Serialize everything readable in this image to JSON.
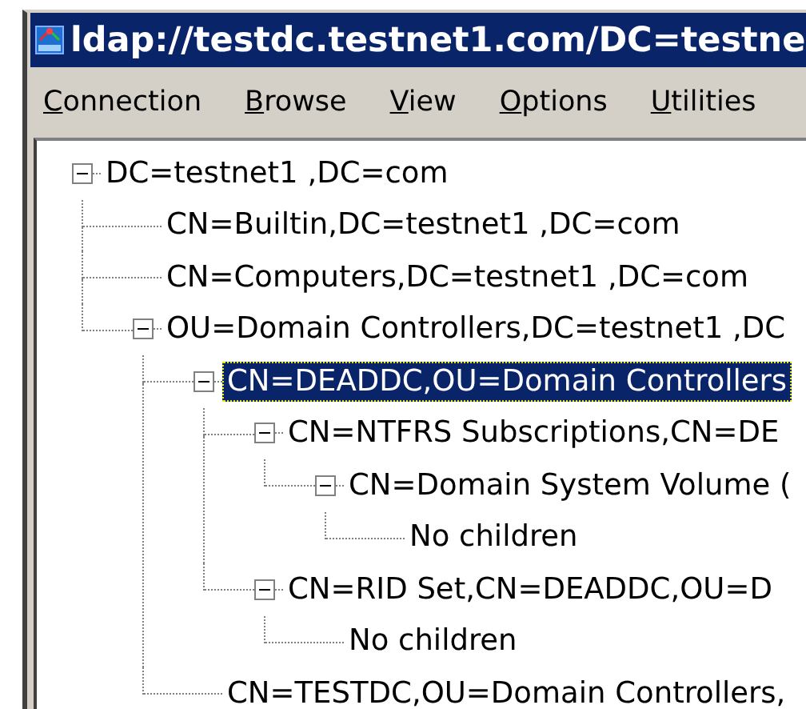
{
  "window": {
    "title": "ldap://testdc.testnet1.com/DC=testne"
  },
  "menu": [
    {
      "label": "Connection"
    },
    {
      "label": "Browse"
    },
    {
      "label": "View"
    },
    {
      "label": "Options"
    },
    {
      "label": "Utilities"
    }
  ],
  "tree": [
    {
      "label": "DC=testnet1 ,DC=com",
      "expanded": true,
      "selected": false,
      "children": [
        {
          "label": "CN=Builtin,DC=testnet1 ,DC=com",
          "selected": false
        },
        {
          "label": "CN=Computers,DC=testnet1 ,DC=com",
          "selected": false
        },
        {
          "label": "OU=Domain Controllers,DC=testnet1 ,DC",
          "expanded": true,
          "selected": false,
          "children": [
            {
              "label": "CN=DEADDC,OU=Domain Controllers",
              "expanded": true,
              "selected": true,
              "children": [
                {
                  "label": "CN=NTFRS Subscriptions,CN=DE",
                  "expanded": true,
                  "selected": false,
                  "children": [
                    {
                      "label": "CN=Domain System Volume (",
                      "expanded": true,
                      "selected": false,
                      "children": [
                        {
                          "label": "No children",
                          "selected": false
                        }
                      ]
                    }
                  ]
                },
                {
                  "label": "CN=RID Set,CN=DEADDC,OU=D",
                  "expanded": true,
                  "selected": false,
                  "children": [
                    {
                      "label": "No children",
                      "selected": false
                    }
                  ]
                }
              ]
            },
            {
              "label": "CN=TESTDC,OU=Domain Controllers,",
              "selected": false
            }
          ]
        }
      ]
    }
  ]
}
